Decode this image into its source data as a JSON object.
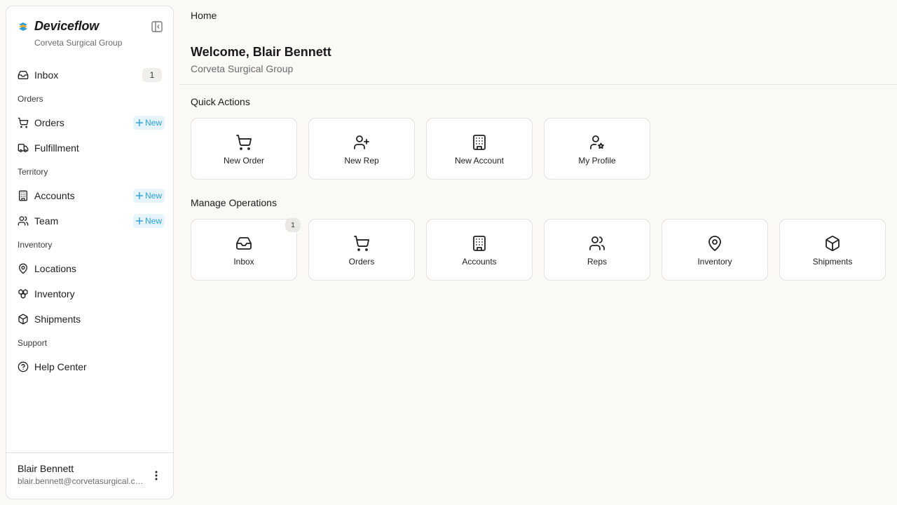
{
  "brand": {
    "name": "Deviceflow",
    "org": "Corveta Surgical Group"
  },
  "sidebar": {
    "inbox": {
      "label": "Inbox",
      "count": "1"
    },
    "sections": {
      "orders": "Orders",
      "territory": "Territory",
      "inventory": "Inventory",
      "support": "Support"
    },
    "items": {
      "orders": {
        "label": "Orders",
        "new": "New"
      },
      "fulfillment": {
        "label": "Fulfillment"
      },
      "accounts": {
        "label": "Accounts",
        "new": "New"
      },
      "team": {
        "label": "Team",
        "new": "New"
      },
      "locations": {
        "label": "Locations"
      },
      "inventory": {
        "label": "Inventory"
      },
      "shipments": {
        "label": "Shipments"
      },
      "help": {
        "label": "Help Center"
      }
    },
    "user": {
      "name": "Blair Bennett",
      "email": "blair.bennett@corvetasurgical.com"
    }
  },
  "main": {
    "breadcrumb": "Home",
    "welcome_title": "Welcome, Blair Bennett",
    "welcome_sub": "Corveta Surgical Group",
    "quick_actions": {
      "title": "Quick Actions",
      "cards": [
        {
          "label": "New Order",
          "icon": "cart-icon"
        },
        {
          "label": "New Rep",
          "icon": "user-plus-icon"
        },
        {
          "label": "New Account",
          "icon": "building-icon"
        },
        {
          "label": "My Profile",
          "icon": "user-star-icon"
        }
      ]
    },
    "manage_operations": {
      "title": "Manage Operations",
      "cards": [
        {
          "label": "Inbox",
          "icon": "inbox-icon",
          "badge": "1"
        },
        {
          "label": "Orders",
          "icon": "cart-icon"
        },
        {
          "label": "Accounts",
          "icon": "building-icon"
        },
        {
          "label": "Reps",
          "icon": "users-icon"
        },
        {
          "label": "Inventory",
          "icon": "map-pin-icon"
        },
        {
          "label": "Shipments",
          "icon": "package-icon"
        }
      ]
    }
  },
  "colors": {
    "accent": "#2a9fd6",
    "logo_blue": "#2a9fd6",
    "logo_orange": "#f5a623",
    "background": "#faf9f6"
  }
}
